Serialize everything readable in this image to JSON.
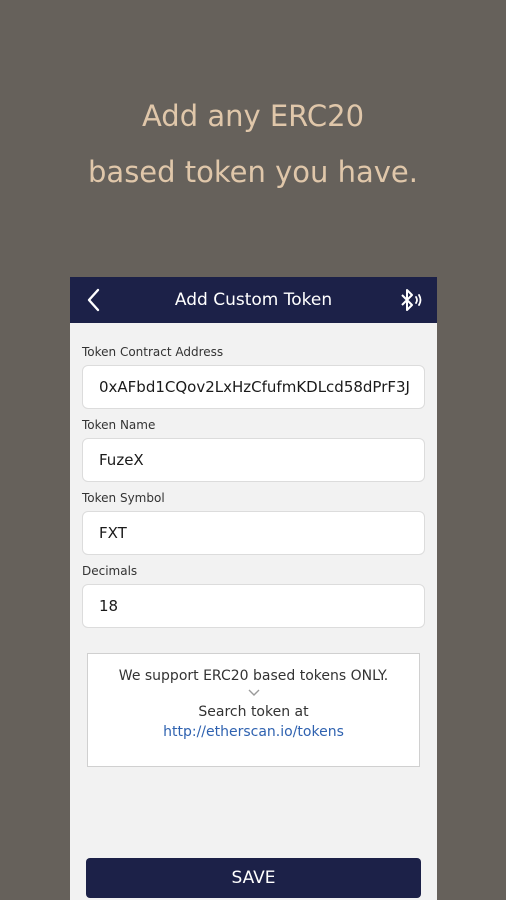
{
  "promo": {
    "line1": "Add any ERC20",
    "line2": "based token you have."
  },
  "appbar": {
    "title": "Add Custom Token",
    "back_icon": "chevron-left-icon",
    "right_icon": "bluetooth-icon"
  },
  "form": {
    "fields": [
      {
        "label": "Token Contract Address",
        "value": "0xAFbd1CQov2LxHzCfufmKDLcd58dPrF3J"
      },
      {
        "label": "Token Name",
        "value": "FuzeX"
      },
      {
        "label": "Token Symbol",
        "value": "FXT"
      },
      {
        "label": "Decimals",
        "value": "18"
      }
    ]
  },
  "notice": {
    "line1": "We support ERC20 based tokens ONLY.",
    "chevron_icon": "chevron-down-icon",
    "line2": "Search token at",
    "link": "http://etherscan.io/tokens"
  },
  "save_label": "SAVE",
  "colors": {
    "background": "#66615b",
    "promo_text": "#e0c7aa",
    "navy": "#1c2148",
    "link": "#2f62b0"
  }
}
